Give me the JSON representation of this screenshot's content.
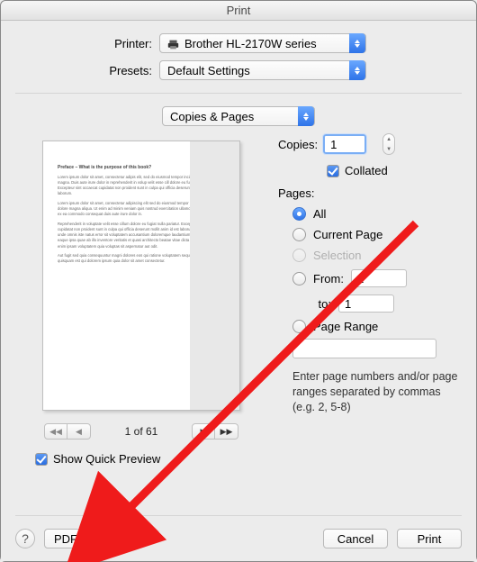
{
  "window": {
    "title": "Print"
  },
  "printer": {
    "label": "Printer:",
    "value": "Brother HL-2170W series"
  },
  "presets": {
    "label": "Presets:",
    "value": "Default Settings"
  },
  "section": {
    "value": "Copies & Pages"
  },
  "copies": {
    "label": "Copies:",
    "value": "1"
  },
  "collated": {
    "label": "Collated",
    "checked": true
  },
  "pages": {
    "label": "Pages:",
    "options": {
      "all": "All",
      "current": "Current Page",
      "selection": "Selection",
      "from": "From:",
      "to": "to:",
      "page_range": "Page Range"
    },
    "from_value": "1",
    "to_value": "1",
    "range_value": "",
    "help": "Enter page numbers and/or page ranges separated by commas (e.g. 2, 5-8)"
  },
  "pager": {
    "label": "1 of 61"
  },
  "show_preview": {
    "label": "Show Quick Preview",
    "checked": true
  },
  "footer": {
    "pdf": "PDF",
    "cancel": "Cancel",
    "print": "Print"
  }
}
